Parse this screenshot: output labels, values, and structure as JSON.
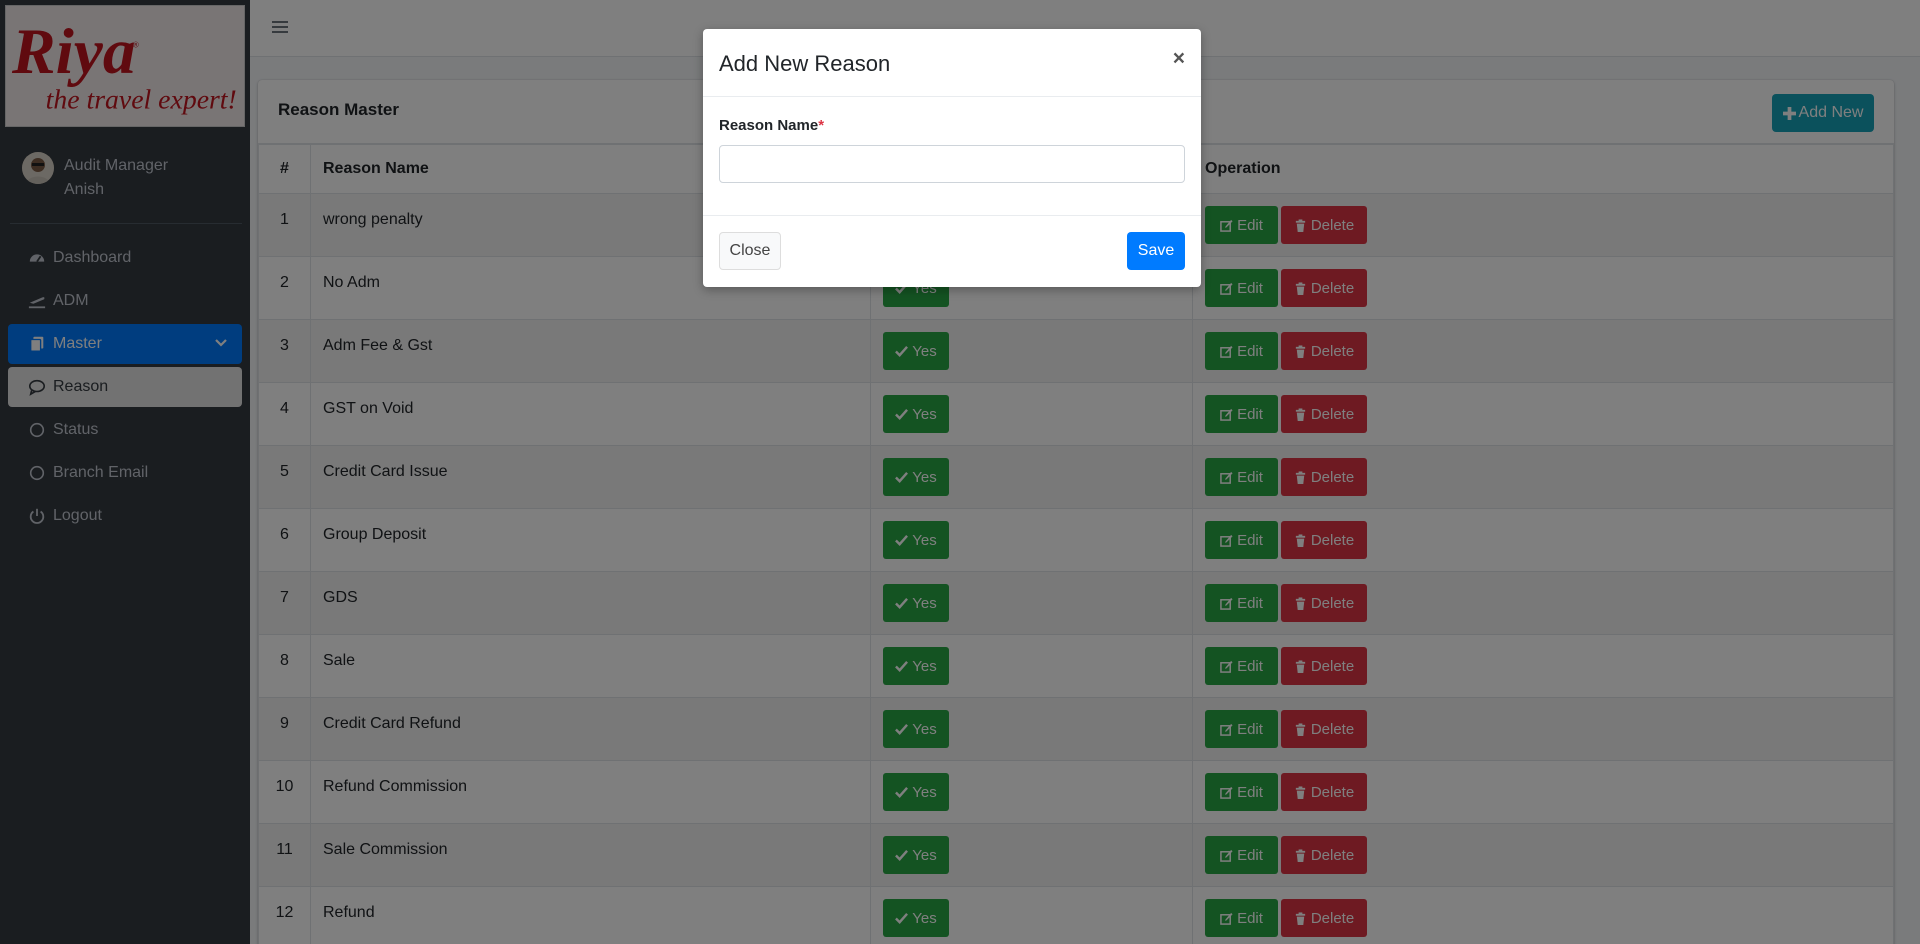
{
  "brand": {
    "logo_text": "Riya",
    "tagline": "the travel expert!"
  },
  "user": {
    "role": "Audit Manager",
    "name": "Anish"
  },
  "nav": {
    "items": [
      {
        "label": "Dashboard",
        "icon": "dashboard-icon"
      },
      {
        "label": "ADM",
        "icon": "plane-departure-icon"
      },
      {
        "label": "Master",
        "icon": "copy-icon"
      },
      {
        "label": "Reason",
        "icon": "comment-icon"
      },
      {
        "label": "Status",
        "icon": "circle-icon"
      },
      {
        "label": "Branch Email",
        "icon": "circle-icon"
      },
      {
        "label": "Logout",
        "icon": "power-icon"
      }
    ]
  },
  "card": {
    "title": "Reason Master",
    "add_new_label": "Add New"
  },
  "table": {
    "headers": [
      "#",
      "Reason Name",
      "",
      "Operation"
    ],
    "yes_label": "Yes",
    "edit_label": "Edit",
    "delete_label": "Delete",
    "rows": [
      {
        "num": "1",
        "name": "wrong penalty"
      },
      {
        "num": "2",
        "name": "No Adm"
      },
      {
        "num": "3",
        "name": "Adm Fee & Gst"
      },
      {
        "num": "4",
        "name": "GST on Void"
      },
      {
        "num": "5",
        "name": "Credit Card Issue"
      },
      {
        "num": "6",
        "name": "Group Deposit"
      },
      {
        "num": "7",
        "name": "GDS"
      },
      {
        "num": "8",
        "name": "Sale"
      },
      {
        "num": "9",
        "name": "Credit Card Refund"
      },
      {
        "num": "10",
        "name": "Refund Commission"
      },
      {
        "num": "11",
        "name": "Sale Commission"
      },
      {
        "num": "12",
        "name": "Refund"
      }
    ]
  },
  "modal": {
    "title": "Add New Reason",
    "close_symbol": "×",
    "field_label": "Reason Name",
    "required_mark": "*",
    "field_value": "",
    "close_label": "Close",
    "save_label": "Save"
  },
  "colors": {
    "sidebar_bg": "#343a40",
    "primary": "#007bff",
    "success": "#28a745",
    "danger": "#dc3545",
    "info": "#17a2b8"
  }
}
